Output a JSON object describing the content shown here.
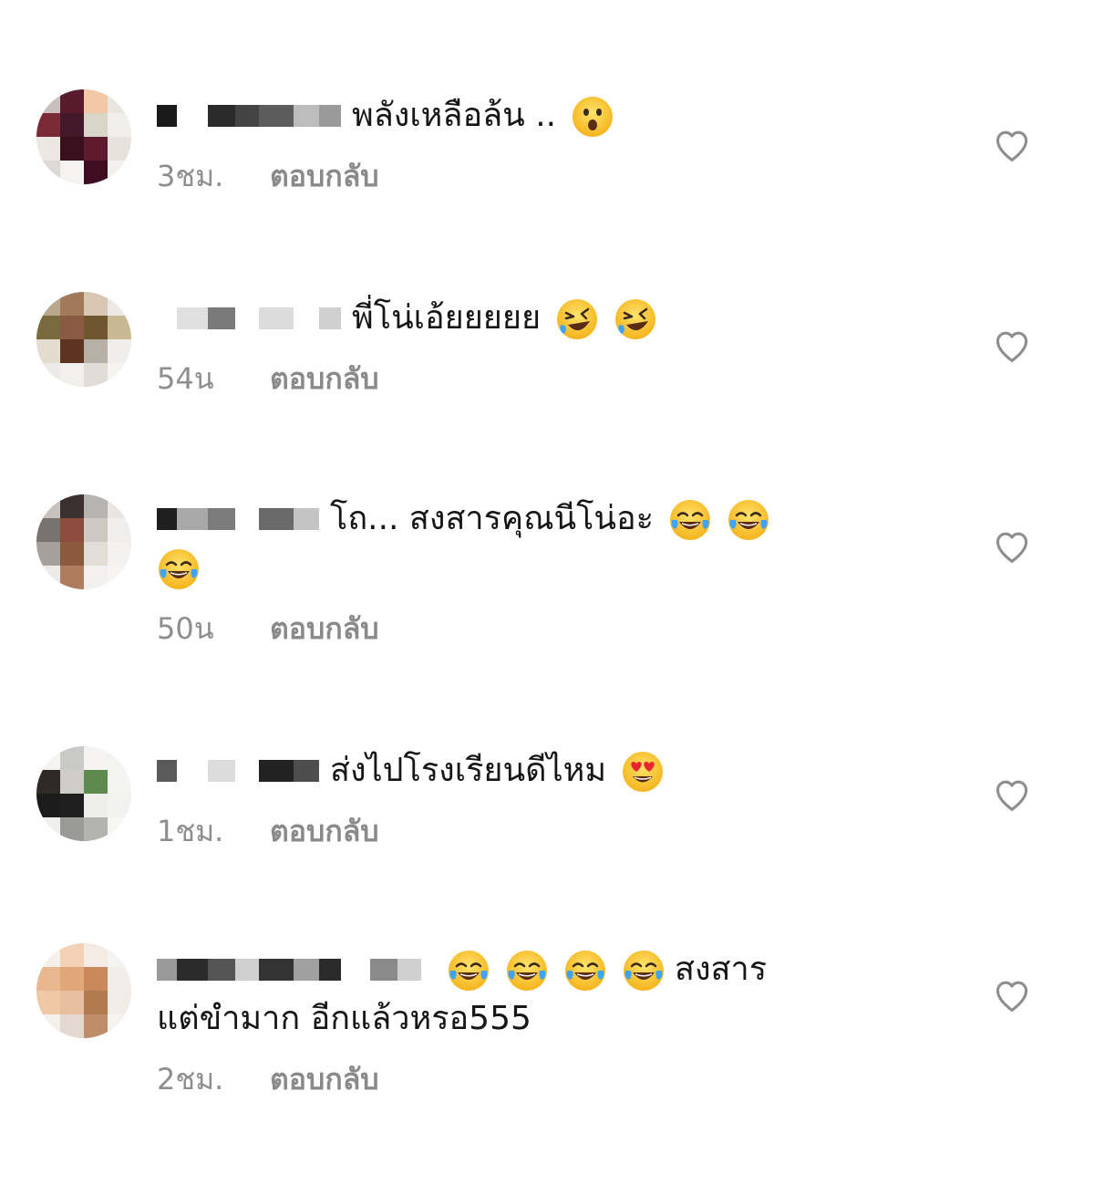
{
  "comments": [
    {
      "text": "พลังเหลือล้น ..",
      "time": "3ชม.",
      "reply": "ตอบกลับ",
      "emojis": [
        "astonished-face"
      ],
      "avatar_colors": [
        "#c9c0bd",
        "#5a1a2d",
        "#f3c8a6",
        "#e9e5df",
        "#7b2b35",
        "#43192a",
        "#d9d6c9",
        "#f1efec",
        "#ece7e0",
        "#3a0f1e",
        "#5e1a2f",
        "#e8e2dd",
        "#dcd9d6",
        "#f5f3f1",
        "#3f0d20",
        "#f2efec"
      ],
      "username_blocks": [
        "#1a1a1a",
        "#ffffff",
        "#2b2b2b",
        "#444444",
        "#5c5c5c",
        "#bdbdbd",
        "#9a9a9a"
      ]
    },
    {
      "text": "พี่โน่เอ้ยยยยย",
      "time": "54น",
      "reply": "ตอบกลับ",
      "emojis": [
        "rolling-on-floor-laughing",
        "rolling-on-floor-laughing"
      ],
      "avatar_colors": [
        "#b8a98c",
        "#a07a5a",
        "#d9c7b4",
        "#ece9e4",
        "#7a6a3d",
        "#8b5a42",
        "#6e5730",
        "#c9b894",
        "#e4dccf",
        "#5c341f",
        "#b6b0a6",
        "#f0eeea",
        "#ecebe7",
        "#f2f0ec",
        "#e0ddd8",
        "#f5f4f1"
      ],
      "username_blocks": [
        "#ffffff",
        "#e0e0e0",
        "#7a7a7a",
        "#ffffff",
        "#dcdcdc",
        "#ffffff",
        "#cfcfcf"
      ]
    },
    {
      "text": "โถ... สงสารคุณนีโน่อะ",
      "time": "50น",
      "reply": "ตอบกลับ",
      "emojis": [
        "face-with-tears-of-joy",
        "face-with-tears-of-joy",
        "face-with-tears-of-joy"
      ],
      "avatar_colors": [
        "#c7c2bd",
        "#3a3030",
        "#b6b3b0",
        "#e8e5e2",
        "#7a726e",
        "#8c4b3c",
        "#cfc9c4",
        "#f1efed",
        "#a69f9a",
        "#8b5a3c",
        "#e3ddd8",
        "#f4f2f0",
        "#ecebe9",
        "#b07c5e",
        "#f2f1ef",
        "#f6f5f3"
      ],
      "username_blocks": [
        "#1f1f1f",
        "#a8a8a8",
        "#7b7b7b",
        "#ffffff",
        "#6a6a6a",
        "#c4c4c4"
      ]
    },
    {
      "text": "ส่งไปโรงเรียนดีไหม",
      "time": "1ชม.",
      "reply": "ตอบกลับ",
      "emojis": [
        "smiling-face-with-heart-eyes"
      ],
      "avatar_colors": [
        "#f5f4f2",
        "#c9c9c7",
        "#f5f4f2",
        "#f3f3f1",
        "#2f2a27",
        "#cfcdc9",
        "#5f8a4e",
        "#f4f4f2",
        "#1b1b1b",
        "#1f1f1f",
        "#eeeeec",
        "#f2f2f0",
        "#efefed",
        "#9a9a98",
        "#b3b3b1",
        "#f6f6f4"
      ],
      "username_blocks": [
        "#5a5a5a",
        "#ffffff",
        "#dcdcdc",
        "#ffffff",
        "#222222",
        "#4d4d4d"
      ]
    },
    {
      "text_line1": "สงสาร",
      "text_line2": "แต่ขำมาก อีกแล้วหรอ555",
      "time": "2ชม.",
      "reply": "ตอบกลับ",
      "emojis": [
        "face-with-tears-of-joy",
        "face-with-tears-of-joy",
        "face-with-tears-of-joy",
        "face-with-tears-of-joy"
      ],
      "avatar_colors": [
        "#f4efe9",
        "#f2d1b5",
        "#f3ebe4",
        "#f5f3f0",
        "#e9b891",
        "#e0a779",
        "#c9895a",
        "#f2ede8",
        "#efc9a6",
        "#e6c0a0",
        "#b27a4f",
        "#f1ece6",
        "#f4efea",
        "#e3d9d2",
        "#c08d6a",
        "#f5f2ef"
      ],
      "username_blocks": [
        "#9a9a9a",
        "#2b2b2b",
        "#555555",
        "#cfcfcf",
        "#333333",
        "#a0a0a0",
        "#2a2a2a",
        "#ffffff",
        "#8a8a8a",
        "#cfcfcf"
      ]
    }
  ],
  "colors": {
    "text": "#161616",
    "meta": "#8e8e8e",
    "heart_stroke": "#8e8e8e",
    "background": "#ffffff"
  },
  "icons": {
    "like": "heart-outline-icon"
  }
}
